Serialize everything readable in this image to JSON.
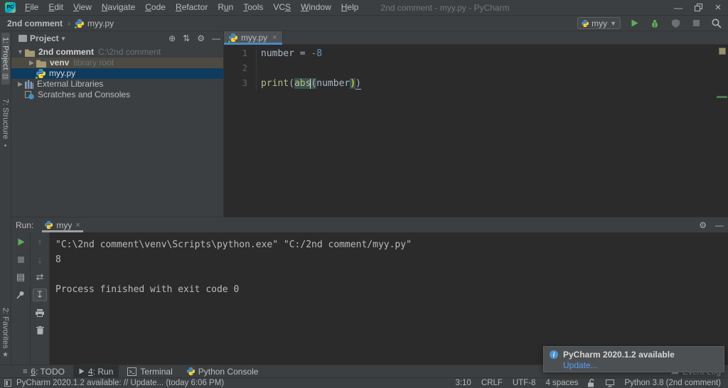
{
  "window": {
    "title": "2nd comment - myy.py - PyCharm"
  },
  "menus": [
    {
      "label": "File",
      "u": 0
    },
    {
      "label": "Edit",
      "u": 0
    },
    {
      "label": "View",
      "u": 0
    },
    {
      "label": "Navigate",
      "u": 0
    },
    {
      "label": "Code",
      "u": 0
    },
    {
      "label": "Refactor",
      "u": 0
    },
    {
      "label": "Run",
      "u": 1
    },
    {
      "label": "Tools",
      "u": 0
    },
    {
      "label": "VCS",
      "u": 2
    },
    {
      "label": "Window",
      "u": 0
    },
    {
      "label": "Help",
      "u": 0
    }
  ],
  "navbar": {
    "breadcrumb_root": "2nd comment",
    "breadcrumb_file": "myy.py",
    "run_config": "myy"
  },
  "stripe": {
    "project": "1: Project",
    "structure": "7: Structure",
    "favorites": "2: Favorites"
  },
  "project": {
    "header": "Project",
    "tree": [
      {
        "name": "2nd comment",
        "suffix": "C:\\2nd comment",
        "icon": "folder",
        "arrow": "down",
        "level": 0,
        "style": "root"
      },
      {
        "name": "venv",
        "suffix": "library root",
        "icon": "folder",
        "arrow": "right",
        "level": 1,
        "style": "library"
      },
      {
        "name": "myy.py",
        "suffix": "",
        "icon": "python",
        "arrow": "none",
        "level": 1,
        "style": "selected"
      },
      {
        "name": "External Libraries",
        "suffix": "",
        "icon": "libraries",
        "arrow": "right",
        "level": 0,
        "style": ""
      },
      {
        "name": "Scratches and Consoles",
        "suffix": "",
        "icon": "scratches",
        "arrow": "none",
        "level": 0,
        "style": ""
      }
    ]
  },
  "editor": {
    "tab": "myy.py",
    "lines": [
      {
        "num": "1",
        "tokens": [
          {
            "t": "number ",
            "c": "id"
          },
          {
            "t": "= ",
            "c": "id"
          },
          {
            "t": "-8",
            "c": "num"
          }
        ]
      },
      {
        "num": "2",
        "tokens": []
      },
      {
        "num": "3",
        "tokens": [
          {
            "t": "print",
            "c": "bi"
          },
          {
            "t": "(",
            "c": "id"
          },
          {
            "t": "abs",
            "c": "bi hl"
          },
          {
            "t": "",
            "c": "caret"
          },
          {
            "t": "(",
            "c": "id hl"
          },
          {
            "t": "number",
            "c": "id"
          },
          {
            "t": ")",
            "c": "y hl"
          },
          {
            "t": ")",
            "c": "id ul"
          }
        ]
      }
    ]
  },
  "run": {
    "label": "Run:",
    "tab": "myy",
    "console": [
      "\"C:\\2nd comment\\venv\\Scripts\\python.exe\" \"C:/2nd comment/myy.py\"",
      "8",
      "",
      "Process finished with exit code 0"
    ]
  },
  "bottom": {
    "items": [
      {
        "label": "6: TODO",
        "u": 0,
        "icon": "list",
        "active": false
      },
      {
        "label": "4: Run",
        "u": 0,
        "icon": "play-small",
        "active": true
      },
      {
        "label": "Terminal",
        "u": -1,
        "icon": "terminal",
        "active": false
      },
      {
        "label": "Python Console",
        "u": -1,
        "icon": "python-mini",
        "active": false
      }
    ],
    "event_log": "Event Log"
  },
  "status": {
    "message": "PyCharm 2020.1.2 available: // Update... (today 6:06 PM)",
    "items": [
      "3:10",
      "CRLF",
      "UTF-8",
      "4 spaces"
    ],
    "interpreter": "Python 3.8 (2nd comment)"
  },
  "notification": {
    "title": "PyCharm 2020.1.2 available",
    "link": "Update..."
  },
  "colors": {
    "accent_blue": "#4a88c7",
    "selection": "#0f3b5e",
    "link": "#589df6",
    "run_green": "#5cad5c",
    "editor_bg": "#2b2b2b"
  }
}
